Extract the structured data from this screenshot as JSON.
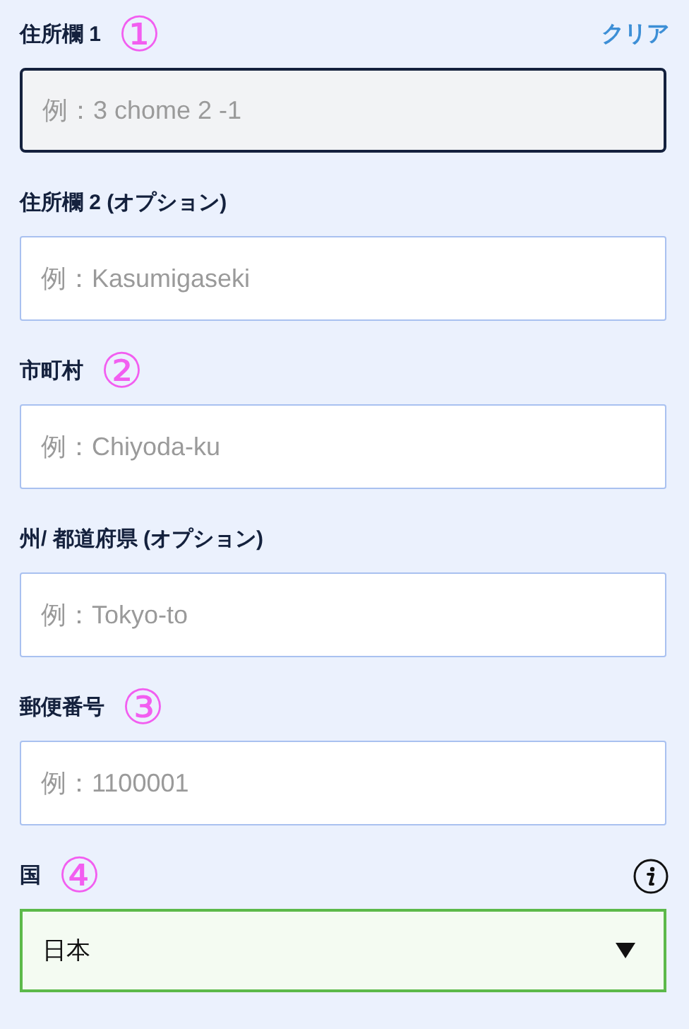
{
  "clear_link": "クリア",
  "fields": [
    {
      "kind": "text",
      "label": "住所欄 1",
      "annotation": "①",
      "placeholder": "例：3 chome 2 -1",
      "focused": true
    },
    {
      "kind": "text",
      "label": "住所欄 2 (オプション)",
      "placeholder": "例：Kasumigaseki",
      "focused": false
    },
    {
      "kind": "text",
      "label": "市町村",
      "annotation": "②",
      "placeholder": "例：Chiyoda-ku",
      "focused": false
    },
    {
      "kind": "text",
      "label": "州/ 都道府県 (オプション)",
      "placeholder": "例：Tokyo-to",
      "focused": false
    },
    {
      "kind": "text",
      "label": "郵便番号",
      "annotation": "③",
      "placeholder": "例：1100001",
      "focused": false
    },
    {
      "kind": "select",
      "label": "国",
      "annotation": "④",
      "value": "日本",
      "info": true
    }
  ]
}
